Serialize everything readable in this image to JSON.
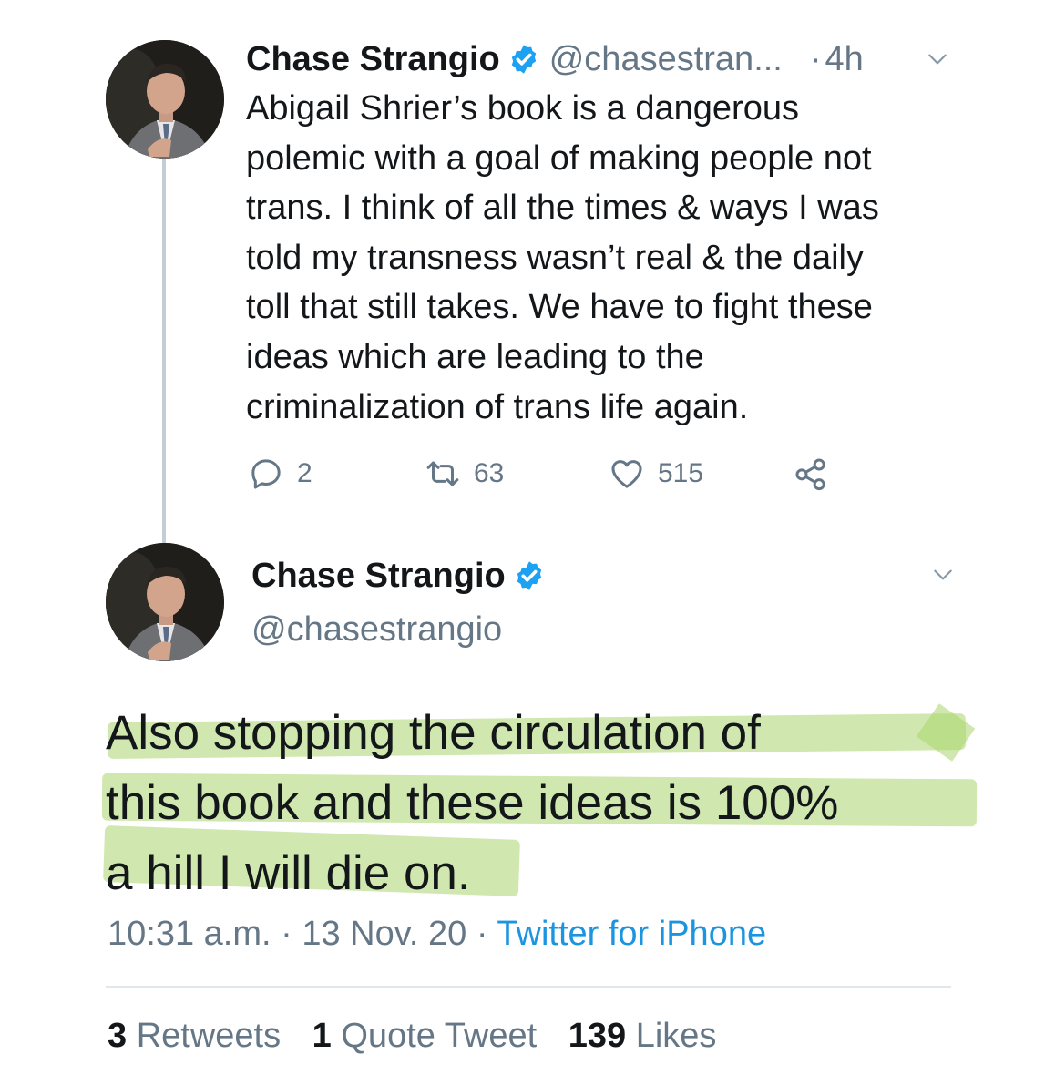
{
  "colors": {
    "link": "#1b95e0",
    "secondary": "#657786",
    "highlight": "#aad66e",
    "verified": "#1da1f2"
  },
  "tweet1": {
    "author_name": "Chase Strangio",
    "handle": "@chasestran...",
    "separator": "·",
    "time": "4h",
    "verified_icon": "verified-badge-icon",
    "body_lines": [
      "Abigail Shrier’s book is a dangerous",
      "polemic with a goal of making people not",
      "trans. I think of all the times & ways I was",
      "told my transness wasn’t real & the daily",
      "toll that still takes. We have to fight these",
      "ideas which are leading to the",
      "criminalization of trans life again."
    ],
    "reply_count": "2",
    "retweet_count": "63",
    "like_count": "515"
  },
  "tweet2": {
    "author_name": "Chase Strangio",
    "handle": "@chasestrangio",
    "body_lines": [
      "Also stopping the circulation of",
      "this book and these ideas is 100%",
      "a hill I will die on."
    ],
    "time": "10:31 a.m.",
    "separator": "·",
    "date": "13 Nov. 20",
    "source": "Twitter for iPhone",
    "stats": {
      "retweets_count": "3",
      "retweets_label": "Retweets",
      "quotes_count": "1",
      "quotes_label": "Quote Tweet",
      "likes_count": "139",
      "likes_label": "Likes"
    }
  }
}
